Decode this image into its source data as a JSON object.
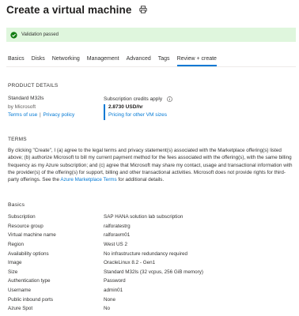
{
  "header": {
    "title": "Create a virtual machine",
    "print_icon": "print-icon"
  },
  "banner": {
    "icon": "check-circle-icon",
    "text": "Validation passed",
    "color": "#dff6dd"
  },
  "tabs": [
    {
      "label": "Basics",
      "active": false
    },
    {
      "label": "Disks",
      "active": false
    },
    {
      "label": "Networking",
      "active": false
    },
    {
      "label": "Management",
      "active": false
    },
    {
      "label": "Advanced",
      "active": false
    },
    {
      "label": "Tags",
      "active": false
    },
    {
      "label": "Review + create",
      "active": true
    }
  ],
  "product": {
    "heading": "PRODUCT DETAILS",
    "name": "Standard M32ls",
    "by": "by Microsoft",
    "terms_link": "Terms of use",
    "separator": "|",
    "privacy_link": "Privacy policy",
    "credits_label": "Subscription credits apply",
    "price": "2.8730 USD/hr",
    "pricing_link": "Pricing for other VM sizes"
  },
  "terms": {
    "heading": "TERMS",
    "body": "By clicking \"Create\", I (a) agree to the legal terms and privacy statement(s) associated with the Marketplace offering(s) listed above; (b) authorize Microsoft to bill my current payment method for the fees associated with the offering(s), with the same billing frequency as my Azure subscription; and (c) agree that Microsoft may share my contact, usage and transactional information with the provider(s) of the offering(s) for support, billing and other transactional activities. Microsoft does not provide rights for third-party offerings. See the ",
    "link": "Azure Marketplace Terms",
    "tail": " for additional details."
  },
  "basics": {
    "heading": "Basics",
    "rows": [
      {
        "label": "Subscription",
        "value": "SAP HANA solution lab subscription"
      },
      {
        "label": "Resource group",
        "value": "ralforatestrg"
      },
      {
        "label": "Virtual machine name",
        "value": "ralforavm01"
      },
      {
        "label": "Region",
        "value": "West US 2"
      },
      {
        "label": "Availability options",
        "value": "No infrastructure redundancy required"
      },
      {
        "label": "Image",
        "value": "OracleLinux 8.2 - Gen1"
      },
      {
        "label": "Size",
        "value": "Standard M32ls (32 vcpus, 256 GiB memory)"
      },
      {
        "label": "Authentication type",
        "value": "Password"
      },
      {
        "label": "Username",
        "value": "admin01"
      },
      {
        "label": "Public inbound ports",
        "value": "None"
      },
      {
        "label": "Azure Spot",
        "value": "No"
      }
    ]
  },
  "colors": {
    "accent": "#0078d4",
    "success_bg": "#dff6dd",
    "success_icon": "#107c10"
  }
}
